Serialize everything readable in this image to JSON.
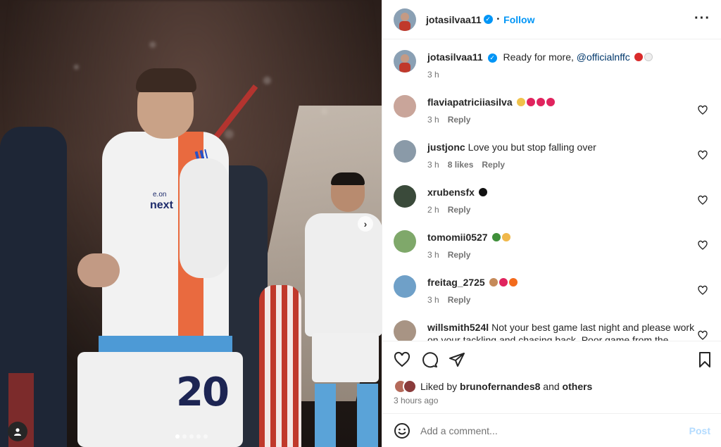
{
  "post": {
    "author": "jotasilvaa11",
    "follow_label": "Follow",
    "separator": "•",
    "more_label": "···",
    "caption_text": "Ready for more,",
    "caption_mention": "@officialnffc",
    "caption_time": "3 h",
    "kit_number": "20",
    "sponsor_top": "e.on",
    "sponsor": "next",
    "carousel_count": 5,
    "carousel_active": 0
  },
  "comments": [
    {
      "user": "flaviapatriciiasilva",
      "text": "",
      "emoji": [
        "clap",
        "red-heart",
        "red-heart",
        "red-heart"
      ],
      "time": "3 h",
      "likes": "",
      "reply": "Reply",
      "avatar_color": "#c9a59a"
    },
    {
      "user": "justjonc",
      "text": "Love you but stop falling over",
      "emoji": [],
      "time": "3 h",
      "likes": "8 likes",
      "reply": "Reply",
      "avatar_color": "#8a9aa8"
    },
    {
      "user": "xrubensfx",
      "text": "",
      "emoji": [
        "black-heart"
      ],
      "time": "2 h",
      "likes": "",
      "reply": "Reply",
      "avatar_color": "#3a4a3a"
    },
    {
      "user": "tomomii0527",
      "text": "",
      "emoji": [
        "tree",
        "hands"
      ],
      "time": "3 h",
      "likes": "",
      "reply": "Reply",
      "avatar_color": "#7fa86a"
    },
    {
      "user": "freitag_2725",
      "text": "",
      "emoji": [
        "muscle",
        "red-heart",
        "fire"
      ],
      "time": "3 h",
      "likes": "",
      "reply": "Reply",
      "avatar_color": "#6fa0c8"
    },
    {
      "user": "willsmith524l",
      "text": "Not your best game last night and please work on your tackling and chasing back. Poor game from the",
      "emoji": [],
      "time": "",
      "likes": "",
      "reply": "",
      "avatar_color": "#a89484"
    }
  ],
  "actions": {
    "liked_by_prefix": "Liked by",
    "liked_by_user": "brunofernandes8",
    "liked_by_and": "and",
    "liked_by_others": "others",
    "time_ago": "3 hours ago"
  },
  "add_comment": {
    "placeholder": "Add a comment...",
    "post_label": "Post"
  },
  "colors": {
    "accent": "#0095f6",
    "muted": "#737373",
    "post_disabled": "#b3dbff"
  }
}
